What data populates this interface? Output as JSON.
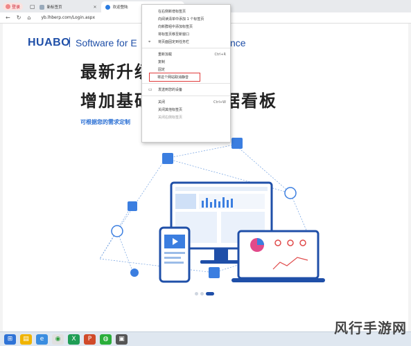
{
  "browser": {
    "profile_label": "登录",
    "tabs": [
      {
        "title": "新标签页"
      },
      {
        "title": "欢迎登陆"
      }
    ],
    "address": "yb.lhberp.com/Login.aspx"
  },
  "page": {
    "logo": "HUABO",
    "tagline_left": "Software for E",
    "tagline_right": "nce",
    "headline_1": "最新升级",
    "headline_2a": "增加基础",
    "headline_2b": "据看板",
    "subtitle": "可根据您的需求定制"
  },
  "context_menu": {
    "items": [
      {
        "label": "在右侧新增标签页",
        "shortcut": ""
      },
      {
        "label": "向阅读清单中添加 1 个标签页",
        "shortcut": ""
      },
      {
        "label": "向新群组中添加标签页",
        "shortcut": ""
      },
      {
        "label": "将标签页移至新窗口",
        "shortcut": ""
      },
      {
        "label": "将页面固定到任务栏",
        "shortcut": ""
      },
      {
        "label": "重新加载",
        "shortcut": "Ctrl+R"
      },
      {
        "label": "复制",
        "shortcut": ""
      },
      {
        "label": "固定",
        "shortcut": ""
      },
      {
        "label": "将这个网站取消静音",
        "shortcut": ""
      },
      {
        "label": "发送到您的设备",
        "shortcut": ""
      },
      {
        "label": "关闭",
        "shortcut": "Ctrl+W"
      },
      {
        "label": "关闭其他标签页",
        "shortcut": ""
      },
      {
        "label": "关闭右侧标签页",
        "shortcut": ""
      }
    ]
  },
  "carousel": {
    "active_index": 3,
    "count": 3
  },
  "watermark": "风行手游网",
  "colors": {
    "brand": "#1f4fa8",
    "highlight_box": "#e03a3a",
    "accent": "#2a6fd4"
  }
}
